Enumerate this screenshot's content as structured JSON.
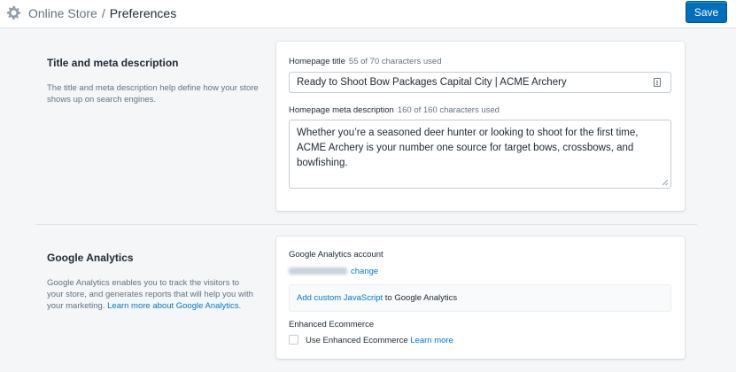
{
  "header": {
    "breadcrumb_parent": "Online Store",
    "breadcrumb_separator": "/",
    "breadcrumb_current": "Preferences",
    "save_label": "Save",
    "accent_color": "#006fbb"
  },
  "title_meta": {
    "title": "Title and meta description",
    "description": "The title and meta description help define how your store shows up on search engines.",
    "homepage_title_label": "Homepage title",
    "homepage_title_hint": "55 of 70 characters used",
    "homepage_title_value": "Ready to Shoot Bow Packages Capital City | ACME Archery",
    "meta_description_label": "Homepage meta description",
    "meta_description_hint": "160 of 160 characters used",
    "meta_description_value": "Whether you’re a seasoned deer hunter or looking to shoot for the first time, ACME Archery is your number one source for target bows, crossbows, and bowfishing."
  },
  "analytics": {
    "title": "Google Analytics",
    "description_prefix": "Google Analytics enables you to track the visitors to your store, and generates reports that will help you with your marketing.",
    "learn_more_link": "Learn more about Google Analytics.",
    "account_label": "Google Analytics account",
    "change_link": "change",
    "custom_js_link": "Add custom JavaScript",
    "custom_js_suffix": "to Google Analytics",
    "enhanced_label": "Enhanced Ecommerce",
    "enhanced_checkbox_label": "Use Enhanced Ecommerce",
    "enhanced_learn_more": "Learn more",
    "enhanced_checked": false
  }
}
